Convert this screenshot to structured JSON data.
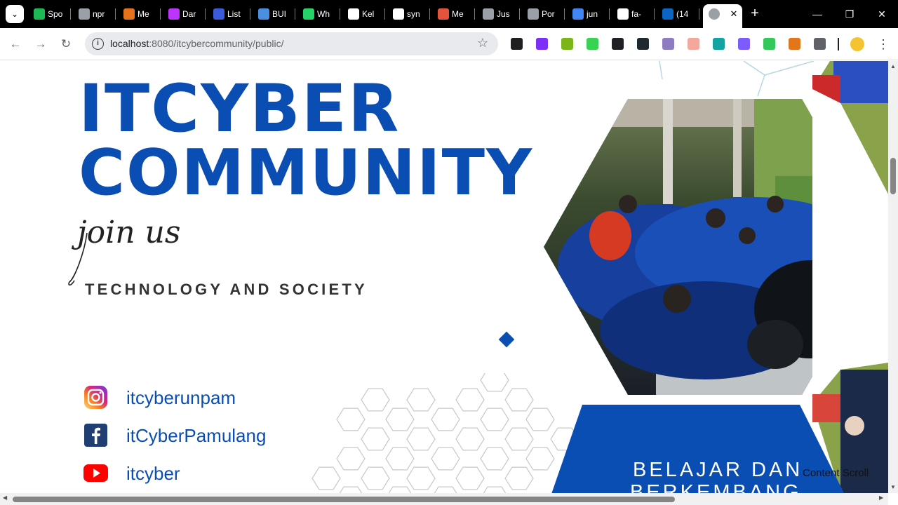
{
  "browser": {
    "tabs": [
      {
        "label": "Spo",
        "icon": "spotify-icon",
        "color": "#1db954"
      },
      {
        "label": "npr",
        "icon": "settings-gear-icon",
        "color": "#9aa0a6"
      },
      {
        "label": "Me",
        "icon": "dashboard-icon",
        "color": "#e8711c"
      },
      {
        "label": "Dar",
        "icon": "vite-icon",
        "color": "#bd34fe"
      },
      {
        "label": "List",
        "icon": "droplet-icon",
        "color": "#3b5bdb"
      },
      {
        "label": "BUI",
        "icon": "hexagon-icon",
        "color": "#4a90e2"
      },
      {
        "label": "Wh",
        "icon": "whatsapp-icon",
        "color": "#25d366"
      },
      {
        "label": "Kel",
        "icon": "sparkle-icon",
        "color": "#ffffff"
      },
      {
        "label": "syn",
        "icon": "github-icon",
        "color": "#ffffff"
      },
      {
        "label": "Me",
        "icon": "image-icon",
        "color": "#e5533d"
      },
      {
        "label": "Jus",
        "icon": "globe-icon",
        "color": "#9aa0a6"
      },
      {
        "label": "Por",
        "icon": "globe-icon",
        "color": "#9aa0a6"
      },
      {
        "label": "jun",
        "icon": "google-icon",
        "color": "#4285f4"
      },
      {
        "label": "fa-",
        "icon": "flag-icon",
        "color": "#ffffff"
      },
      {
        "label": "(14",
        "icon": "linkedin-icon",
        "color": "#0a66c2"
      }
    ],
    "active_tab_close": "✕",
    "new_tab": "+",
    "window_controls": {
      "minimize": "—",
      "maximize": "❐",
      "close": "✕"
    },
    "url_host": "localhost",
    "url_rest": ":8080/itcybercommunity/public/",
    "extensions": [
      {
        "icon": "ruler-extension-icon",
        "color": "#1f1f1f"
      },
      {
        "icon": "play-extension-icon",
        "color": "#7b2ff7"
      },
      {
        "icon": "chart-extension-icon",
        "color": "#7cb518"
      },
      {
        "icon": "x-extension-icon",
        "color": "#39d353"
      },
      {
        "icon": "dots-extension-icon",
        "color": "#202124"
      },
      {
        "icon": "hash-extension-icon",
        "color": "#1e2a2f"
      },
      {
        "icon": "cloud-extension-icon",
        "color": "#8e7cc3"
      },
      {
        "icon": "n-extension-icon",
        "color": "#f4a79d"
      },
      {
        "icon": "circle-extension-icon",
        "color": "#14a3a3"
      },
      {
        "icon": "square-extension-icon",
        "color": "#7c5cff"
      },
      {
        "icon": "diamond-extension-icon",
        "color": "#34c759"
      },
      {
        "icon": "fox-extension-icon",
        "color": "#e2761b"
      },
      {
        "icon": "puzzle-extension-icon",
        "color": "#5f6368"
      }
    ]
  },
  "page": {
    "title_line1": "ITCYBER",
    "title_line2": "COMMUNITY",
    "script_text": "join us",
    "tagline": "TECHNOLOGY AND SOCIETY",
    "brand_color": "#0a4db3",
    "socials": [
      {
        "platform": "instagram",
        "handle": "itcyberunpam"
      },
      {
        "platform": "facebook",
        "handle": "itCyberPamulang"
      },
      {
        "platform": "youtube",
        "handle": "itcyber"
      }
    ],
    "banner_line1": "BELAJAR DAN",
    "banner_line2": "BERKEMBANG",
    "overlay_text": "Content Scroll"
  }
}
